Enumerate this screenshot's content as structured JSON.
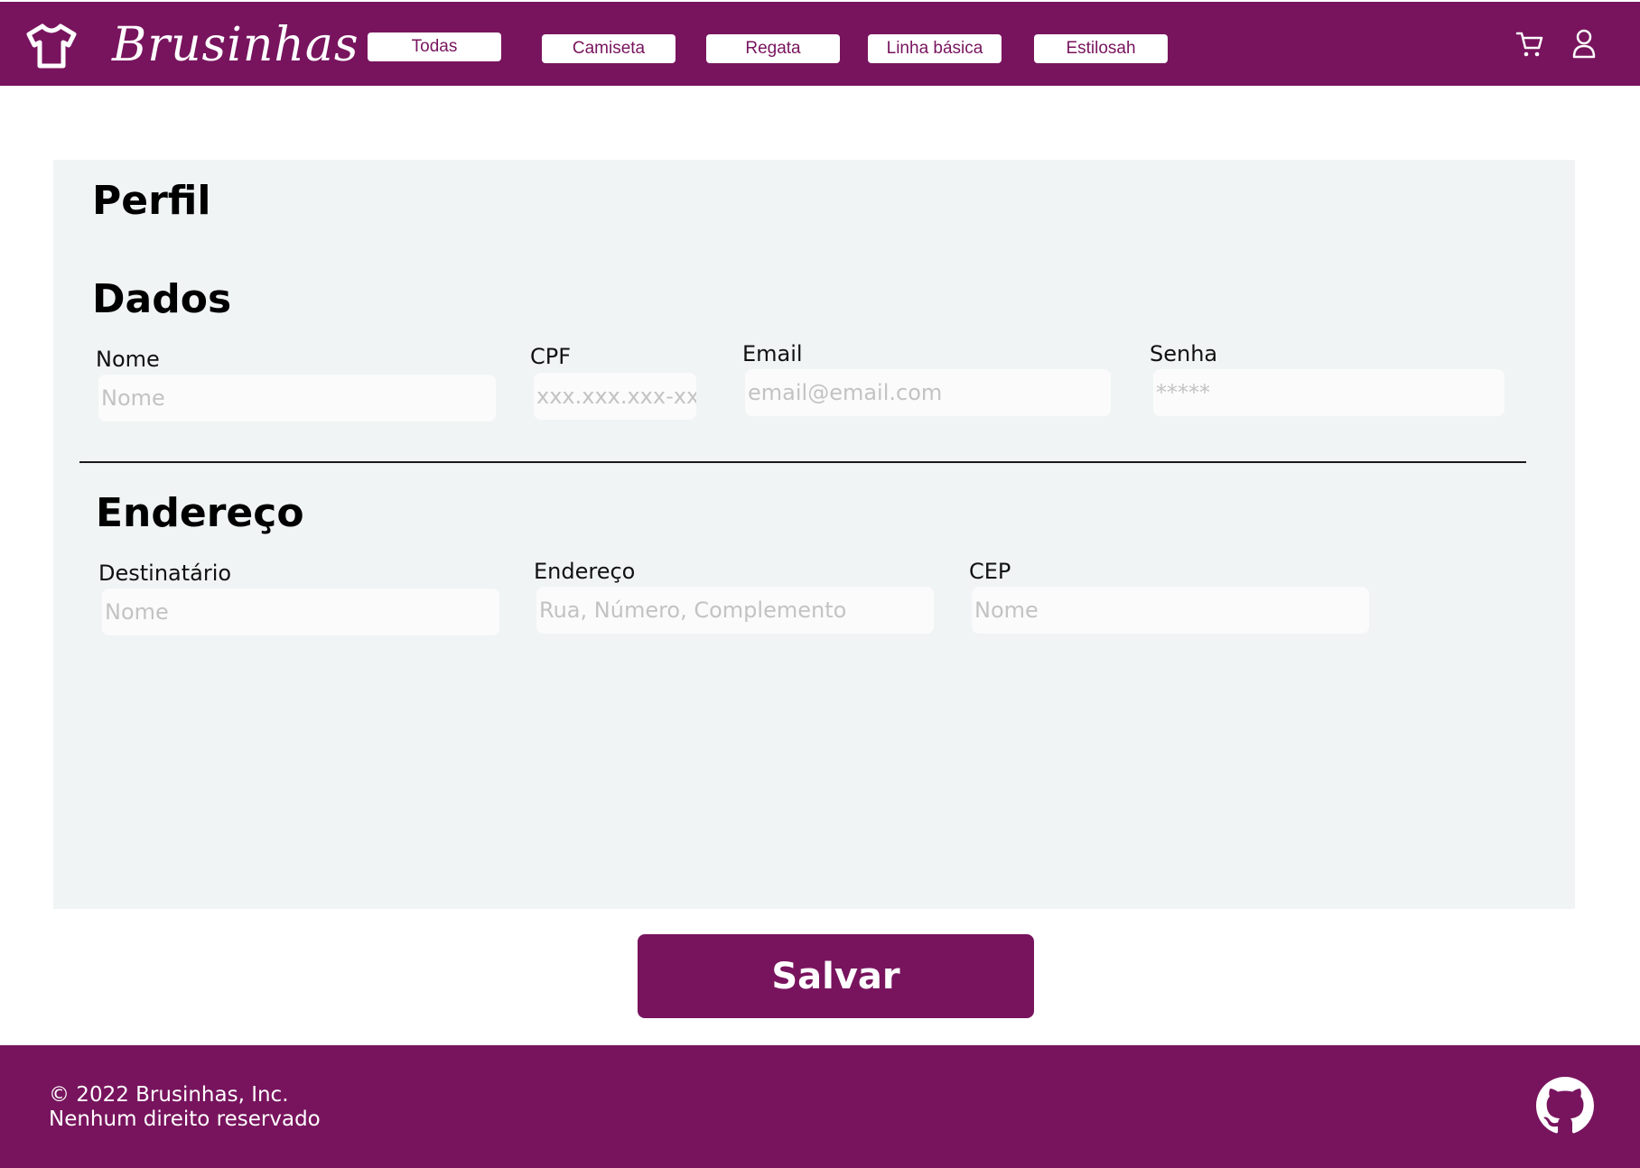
{
  "header": {
    "brand": "Brusinhas",
    "logo_icon": "tshirt-icon",
    "nav": [
      "Todas",
      "Camiseta",
      "Regata",
      "Linha básica",
      "Estilosah"
    ],
    "cart_icon": "cart-icon",
    "user_icon": "user-icon"
  },
  "profile": {
    "title": "Perfil",
    "dados": {
      "title": "Dados",
      "nome": {
        "label": "Nome",
        "placeholder": "Nome"
      },
      "cpf": {
        "label": "CPF",
        "placeholder": "xxx.xxx.xxx-xx"
      },
      "email": {
        "label": "Email",
        "placeholder": "email@email.com"
      },
      "senha": {
        "label": "Senha",
        "placeholder": "*****"
      }
    },
    "endereco": {
      "title": "Endereço",
      "destinatario": {
        "label": "Destinatário",
        "placeholder": "Nome"
      },
      "endereco": {
        "label": "Endereço",
        "placeholder": "Rua, Número, Complemento"
      },
      "cep": {
        "label": "CEP",
        "placeholder": "Nome"
      }
    }
  },
  "actions": {
    "save_label": "Salvar"
  },
  "footer": {
    "copyright": "© 2022 Brusinhas, Inc.",
    "rights": "Nenhum direito reservado",
    "github_icon": "github-icon"
  },
  "colors": {
    "brand": "#78145e",
    "panel_bg": "#f0f4f4",
    "input_bg": "#fbfbfb",
    "placeholder": "#c3c3c3"
  }
}
